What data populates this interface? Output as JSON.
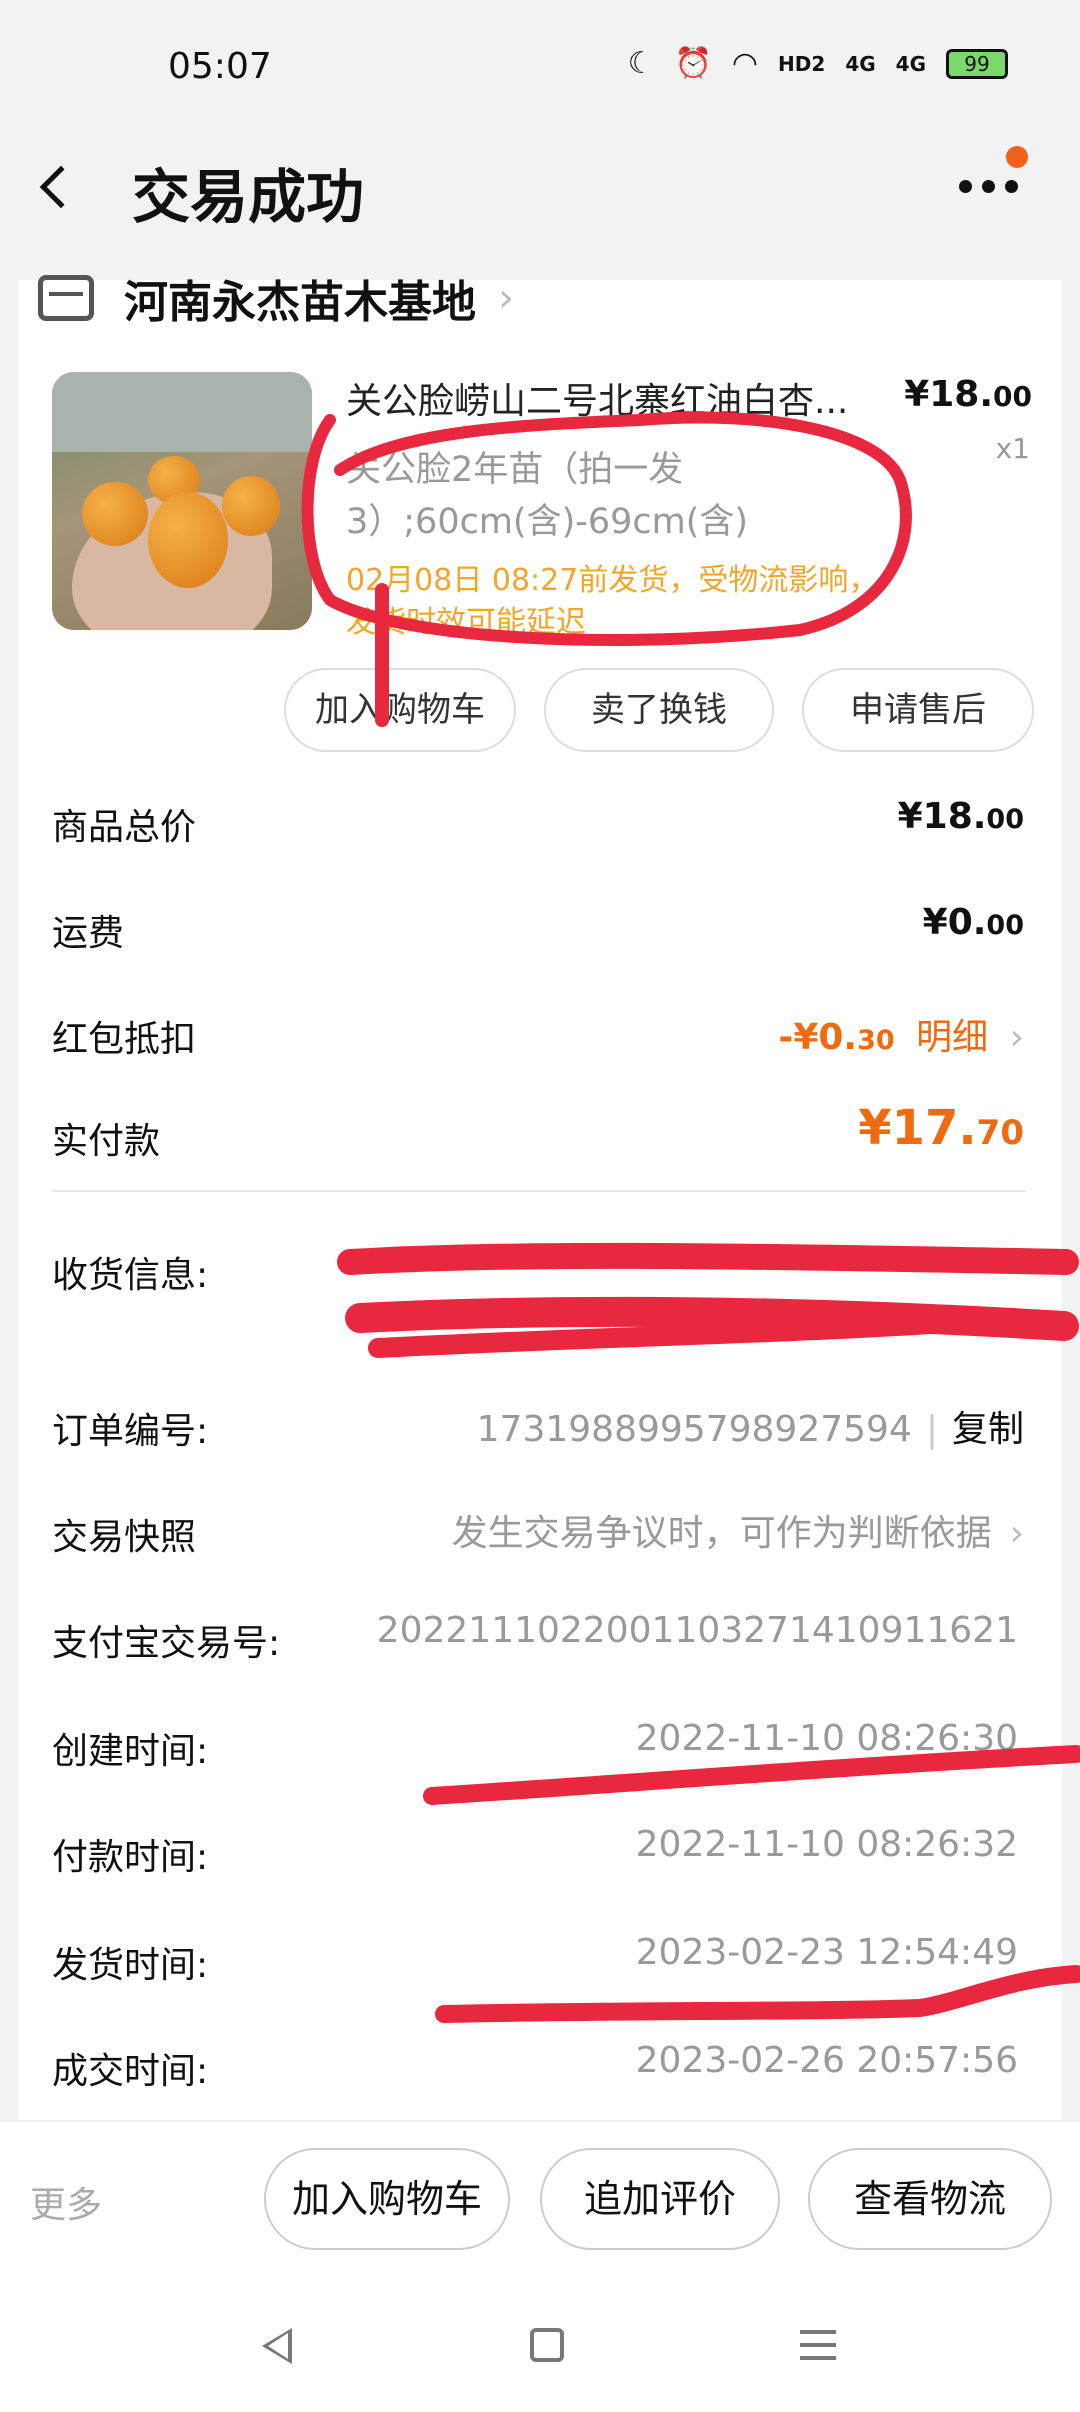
{
  "status_bar": {
    "time": "05:07",
    "battery": "99",
    "net1": "4G",
    "net2": "4G",
    "hd": "HD2"
  },
  "header": {
    "title": "交易成功"
  },
  "store": {
    "name": "河南永杰苗木基地"
  },
  "product": {
    "title": "关公脸崂山二号北寨红油白杏...",
    "price_main": "¥18.",
    "price_cents": "00",
    "qty": "x1",
    "spec": "关公脸2年苗（拍一发3）;60cm(含)-69cm(含)",
    "ship_note": "02月08日 08:27前发货，受物流影响，发货时效可能延迟",
    "actions": [
      "加入购物车",
      "卖了换钱",
      "申请售后"
    ]
  },
  "summary": {
    "goods_total_label": "商品总价",
    "goods_total_main": "¥18.",
    "goods_total_cents": "00",
    "shipping_label": "运费",
    "shipping_main": "¥0.",
    "shipping_cents": "00",
    "redpacket_label": "红包抵扣",
    "redpacket_main": "-¥0.",
    "redpacket_cents": "30",
    "redpacket_detail": "明细",
    "paid_label": "实付款",
    "paid_main": "¥17.",
    "paid_cents": "70"
  },
  "info": {
    "address_label": "收货信息:",
    "order_no_label": "订单编号:",
    "order_no": "1731988995798927594",
    "copy": "复制",
    "snapshot_label": "交易快照",
    "snapshot_value": "发生交易争议时，可作为判断依据",
    "alipay_label": "支付宝交易号:",
    "alipay_no": "2022111022001103271410911621",
    "created_label": "创建时间:",
    "created": "2022-11-10 08:26:30",
    "paid_time_label": "付款时间:",
    "paid_time": "2022-11-10 08:26:32",
    "shipped_label": "发货时间:",
    "shipped": "2023-02-23 12:54:49",
    "closed_label": "成交时间:",
    "closed": "2023-02-26 20:57:56"
  },
  "bottom_bar": {
    "more": "更多",
    "add_cart": "加入购物车",
    "add_review": "追加评价",
    "view_logistics": "查看物流"
  },
  "colors": {
    "accent": "#f06a0f",
    "ship_note": "#f3a52b",
    "annotation": "#e8283f"
  }
}
